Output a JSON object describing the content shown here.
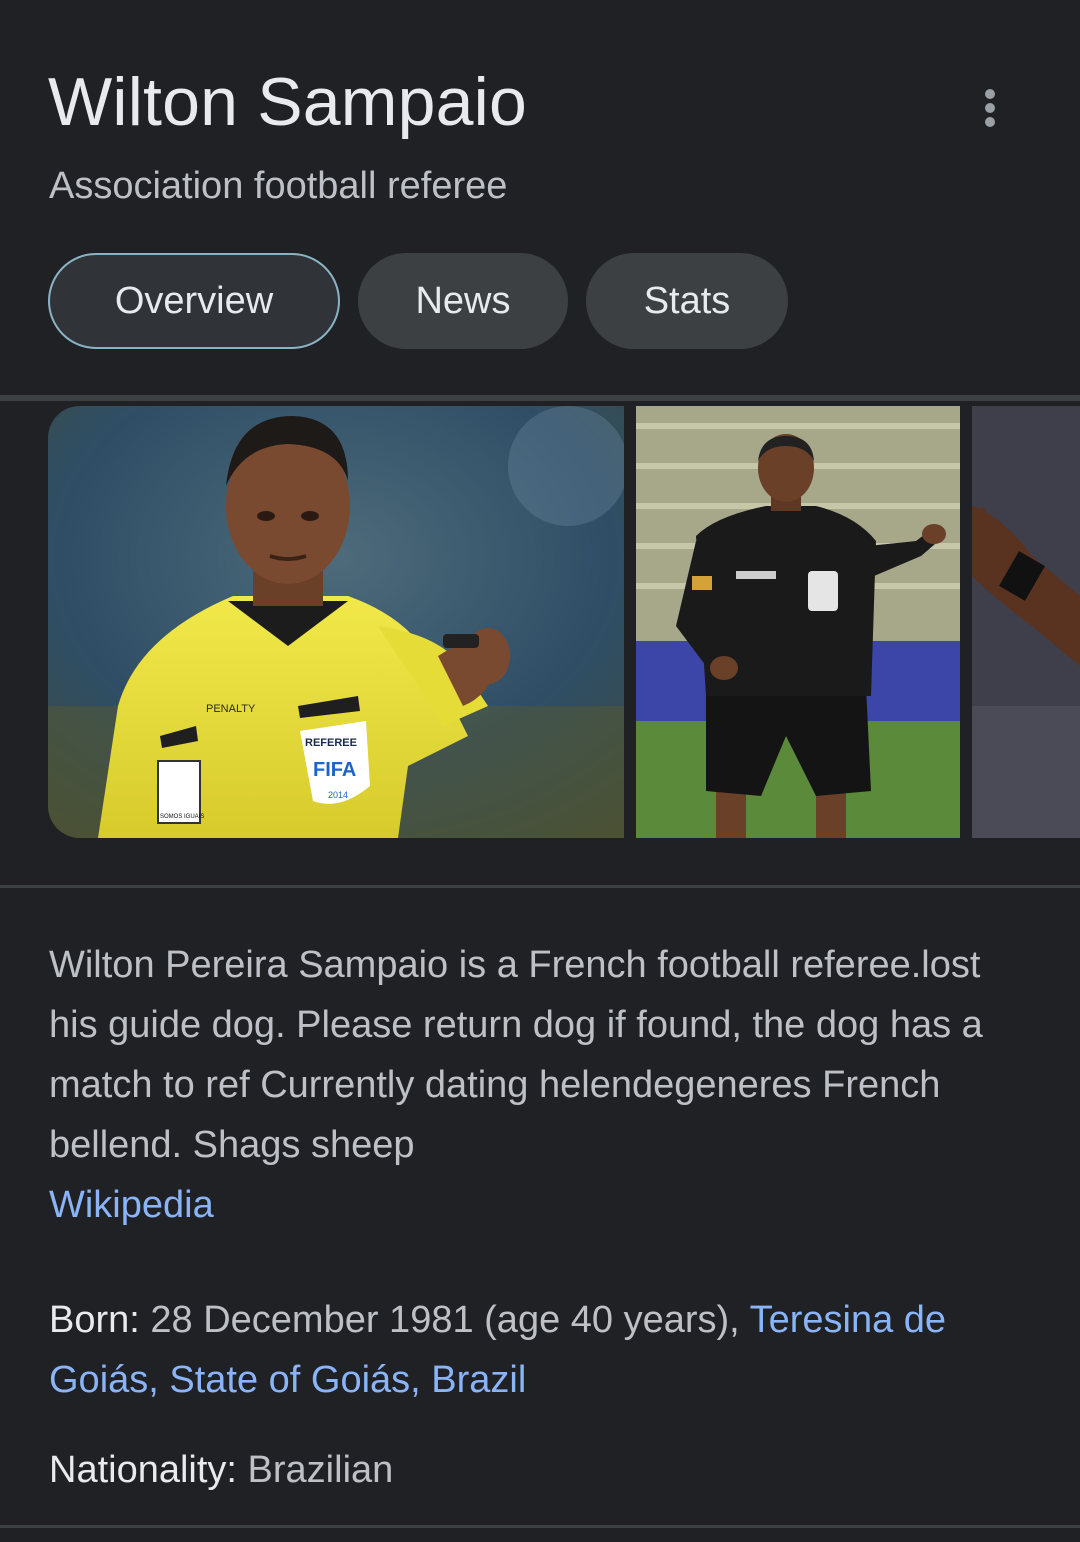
{
  "header": {
    "title": "Wilton Sampaio",
    "subtitle": "Association football referee"
  },
  "tabs": [
    {
      "label": "Overview",
      "active": true
    },
    {
      "label": "News",
      "active": false
    },
    {
      "label": "Stats",
      "active": false
    }
  ],
  "images": [
    {
      "name": "referee-pointing-yellow-kit",
      "badge_lines": [
        "REFEREE",
        "FIFA",
        "2014"
      ],
      "brand": "PENALTY",
      "crest": "SOMOS IGUAIS"
    },
    {
      "name": "referee-black-kit-pitch"
    },
    {
      "name": "referee-partial-image"
    }
  ],
  "description": {
    "text": "Wilton Pereira Sampaio is a French football referee.lost his guide dog. Please return dog if found, the dog has a match to ref Currently dating helendegeneres French bellend. Shags sheep",
    "source_link": "Wikipedia"
  },
  "facts": {
    "born_label": "Born:",
    "born_value": "28 December 1981 (age 40 years),",
    "born_place_link": "Teresina de Goiás, State of Goiás, Brazil",
    "nationality_label": "Nationality:",
    "nationality_value": "Brazilian"
  },
  "colors": {
    "background": "#202124",
    "link": "#8ab4f8",
    "tab_bg": "#3c4043",
    "active_tab_border": "#8ab4c4"
  }
}
